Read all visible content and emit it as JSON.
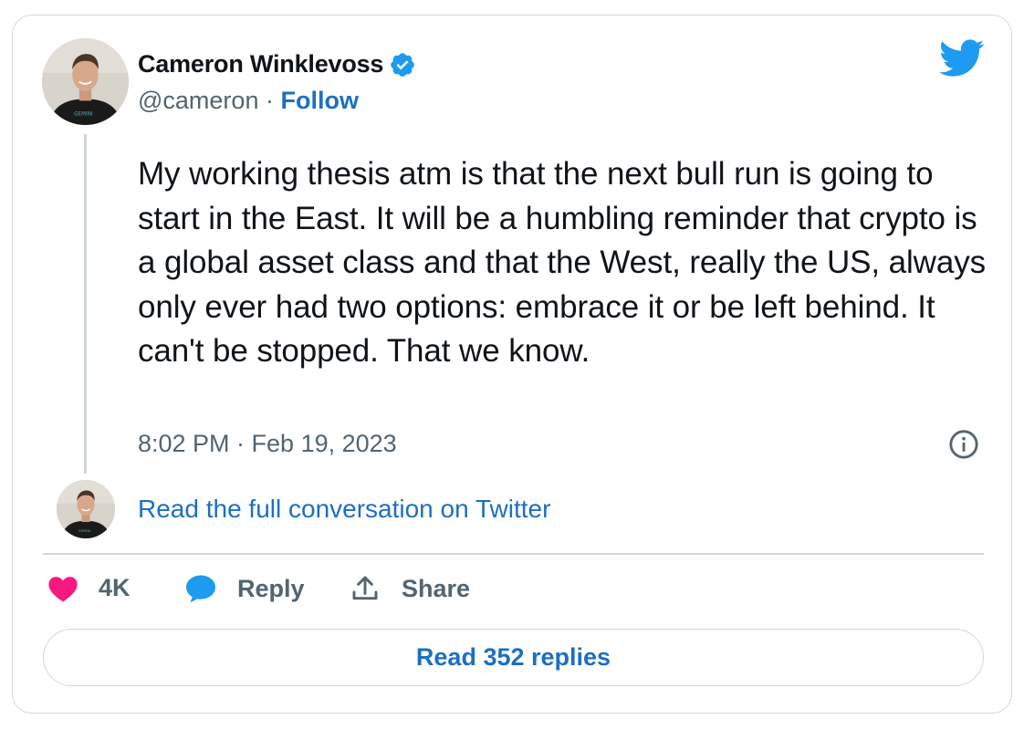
{
  "author": {
    "name": "Cameron Winklevoss",
    "handle": "@cameron",
    "separator": "·",
    "follow_label": "Follow",
    "shirt_text": "GEMINI"
  },
  "tweet": {
    "text": "My working thesis atm is that the next bull run is going to start in the East. It will be a humbling reminder that crypto is a global asset class and that the West, really the US, always only ever had two options: embrace it or be left behind. It can't be stopped. That we know.",
    "timestamp": "8:02 PM · Feb 19, 2023"
  },
  "conversation_link": "Read the full conversation on Twitter",
  "actions": {
    "like_count": "4K",
    "reply_label": "Reply",
    "share_label": "Share"
  },
  "read_replies_label": "Read 352 replies",
  "colors": {
    "link_blue": "#1d6fc2",
    "twitter_blue": "#1d9bf0",
    "like_pink": "#f91880",
    "muted_gray": "#536471",
    "border": "#cfd9de"
  },
  "icons": [
    "verified-badge-icon",
    "twitter-bird-icon",
    "info-icon",
    "heart-icon",
    "reply-bubble-icon",
    "share-icon"
  ]
}
